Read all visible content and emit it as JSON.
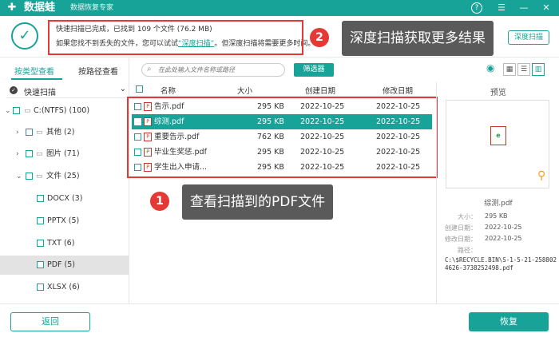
{
  "titlebar": {
    "logo": "✚",
    "app_name": "数据蛙",
    "app_sub": "数据恢复专家",
    "help_icon": "?",
    "menu_icon": "☰",
    "min_icon": "—",
    "close_icon": "✕"
  },
  "status": {
    "line1": "快速扫描已完成，已找到 109 个文件 (76.2 MB)",
    "line2_prefix": "如果您找不到丢失的文件，您可以试试",
    "line2_link": "“深度扫描”",
    "line2_suffix": "。但深度扫描将需要更多时间。",
    "deep_button": "深度扫描"
  },
  "callouts": {
    "c1_num": "1",
    "c1_text": "查看扫描到的PDF文件",
    "c2_num": "2",
    "c2_text": "深度扫描获取更多结果"
  },
  "left": {
    "tab_type": "按类型查看",
    "tab_path": "按路径查看",
    "scan_mode": "快速扫描",
    "tree": [
      {
        "label": "C:(NTFS) (100)",
        "icon": "▭"
      },
      {
        "label": "其他 (2)",
        "icon": "▭"
      },
      {
        "label": "图片 (71)",
        "icon": "▭"
      },
      {
        "label": "文件 (25)",
        "icon": "▭"
      },
      {
        "label": "DOCX (3)"
      },
      {
        "label": "PPTX (5)"
      },
      {
        "label": "TXT (6)"
      },
      {
        "label": "PDF (5)"
      },
      {
        "label": "XLSX (6)"
      }
    ]
  },
  "toolbar": {
    "search_placeholder": "在此处输入文件名称或路径",
    "filter_button": "筛选器"
  },
  "table": {
    "headers": {
      "name": "名称",
      "size": "大小",
      "created": "创建日期",
      "modified": "修改日期"
    },
    "rows": [
      {
        "name": "告示.pdf",
        "size": "295 KB",
        "created": "2022-10-25",
        "modified": "2022-10-25"
      },
      {
        "name": "综测.pdf",
        "size": "295 KB",
        "created": "2022-10-25",
        "modified": "2022-10-25"
      },
      {
        "name": "重要告示.pdf",
        "size": "762 KB",
        "created": "2022-10-25",
        "modified": "2022-10-25"
      },
      {
        "name": "毕业生奖惩.pdf",
        "size": "295 KB",
        "created": "2022-10-25",
        "modified": "2022-10-25"
      },
      {
        "name": "学生出入申请...",
        "size": "295 KB",
        "created": "2022-10-25",
        "modified": "2022-10-25"
      }
    ]
  },
  "preview": {
    "title": "预览",
    "file_name": "综测.pdf",
    "size_label": "大小：",
    "size_value": "295 KB",
    "created_label": "创建日期：",
    "created_value": "2022-10-25",
    "modified_label": "修改日期：",
    "modified_value": "2022-10-25",
    "path_label": "路径：",
    "path_value": "C:\\$RECYCLE.BIN\\S-1-5-21-2588024626-3738252498.pdf"
  },
  "bottom": {
    "back_button": "返回",
    "recover_button": "恢复"
  },
  "colors": {
    "accent": "#17a398",
    "highlight": "#e53935"
  }
}
